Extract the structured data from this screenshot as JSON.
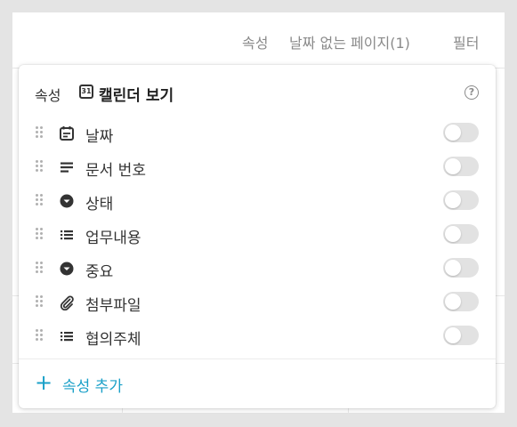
{
  "colors": {
    "accent": "#1aa0c8",
    "toggle_off": "#e2e2e2",
    "text_main": "#333333",
    "text_muted": "#8a8a8a"
  },
  "topbar": {
    "property_label": "속성",
    "no_date_pages_label": "날짜 없는 페이지(1)",
    "filter_label": "필터"
  },
  "popup": {
    "header": {
      "property_label": "속성",
      "view_icon": "calendar-icon",
      "view_icon_text": "31",
      "view_title": "캘린더 보기",
      "help_icon": "help-circle-icon",
      "help_icon_text": "?"
    },
    "fields": [
      {
        "label": "날짜",
        "icon": "calendar-date-icon",
        "enabled": false
      },
      {
        "label": "문서 번호",
        "icon": "text-lines-icon",
        "enabled": false
      },
      {
        "label": "상태",
        "icon": "select-circle-icon",
        "enabled": false
      },
      {
        "label": "업무내용",
        "icon": "list-icon",
        "enabled": false
      },
      {
        "label": "중요",
        "icon": "select-circle-icon",
        "enabled": false
      },
      {
        "label": "첨부파일",
        "icon": "paperclip-icon",
        "enabled": false
      },
      {
        "label": "협의주체",
        "icon": "list-icon",
        "enabled": false
      }
    ],
    "add_property": {
      "icon": "plus-icon",
      "icon_text": "+",
      "label": "속성 추가"
    }
  }
}
